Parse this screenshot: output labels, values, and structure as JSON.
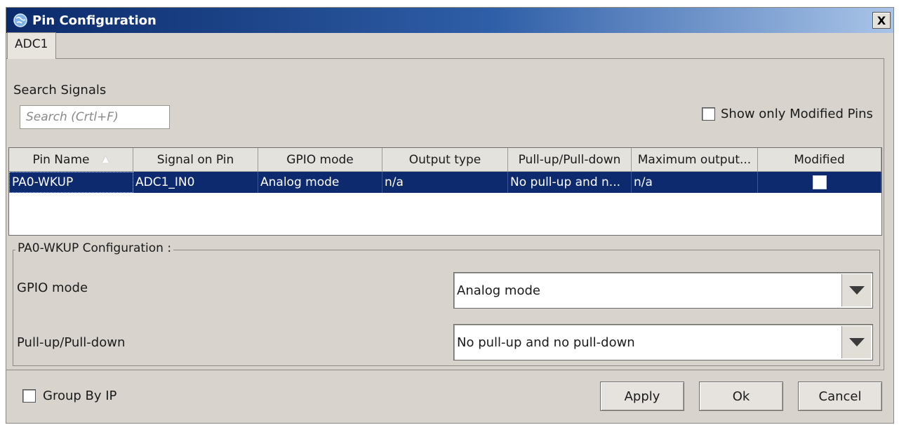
{
  "window": {
    "title": "Pin Configuration",
    "close_label": "X"
  },
  "tabs": [
    {
      "label": "ADC1"
    }
  ],
  "search": {
    "label": "Search Signals",
    "placeholder": "Search (Crtl+F)"
  },
  "filter": {
    "show_modified_label": "Show only Modified Pins",
    "show_modified_checked": false
  },
  "table": {
    "columns": [
      "Pin Name",
      "Signal on Pin",
      "GPIO mode",
      "Output type",
      "Pull-up/Pull-down",
      "Maximum output...",
      "Modified"
    ],
    "sort_column": "Pin Name",
    "rows": [
      {
        "pin_name": "PA0-WKUP",
        "signal": "ADC1_IN0",
        "gpio_mode": "Analog mode",
        "output_type": "n/a",
        "pull": "No pull-up and n...",
        "max_output": "n/a",
        "modified": false
      }
    ]
  },
  "config": {
    "title": "PA0-WKUP Configuration :",
    "gpio_mode": {
      "label": "GPIO mode",
      "value": "Analog mode"
    },
    "pull": {
      "label": "Pull-up/Pull-down",
      "value": "No pull-up and no pull-down"
    }
  },
  "footer": {
    "group_by_label": "Group By IP",
    "group_by_checked": false
  },
  "buttons": {
    "apply": "Apply",
    "ok": "Ok",
    "cancel": "Cancel"
  },
  "colors": {
    "title_start": "#0b2a6a",
    "selection": "#0e2a6e",
    "background": "#d8d4cd"
  }
}
